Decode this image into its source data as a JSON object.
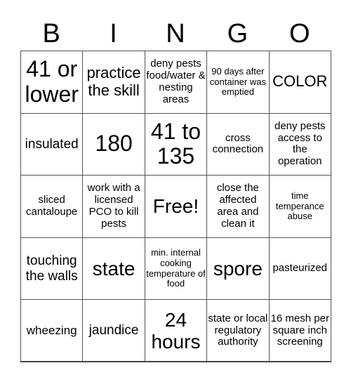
{
  "header": {
    "letters": [
      "B",
      "I",
      "N",
      "G",
      "O"
    ]
  },
  "board": {
    "rows": [
      [
        "41 or lower",
        "practice the skill",
        "deny pests food/water & nesting areas",
        "90 days after container was emptied",
        "COLOR"
      ],
      [
        "insulated",
        "180",
        "41 to 135",
        "cross connection",
        "deny pests access to the operation"
      ],
      [
        "sliced cantaloupe",
        "work with a licensed PCO to kill pests",
        "Free!",
        "close the affected area and clean it",
        "time temperance abuse"
      ],
      [
        "touching the walls",
        "state",
        "min. internal cooking temperature of food",
        "spore",
        "pasteurized"
      ],
      [
        "wheezing",
        "jaundice",
        "24 hours",
        "state or local regulatory authority",
        "16 mesh per square inch screening"
      ]
    ]
  }
}
